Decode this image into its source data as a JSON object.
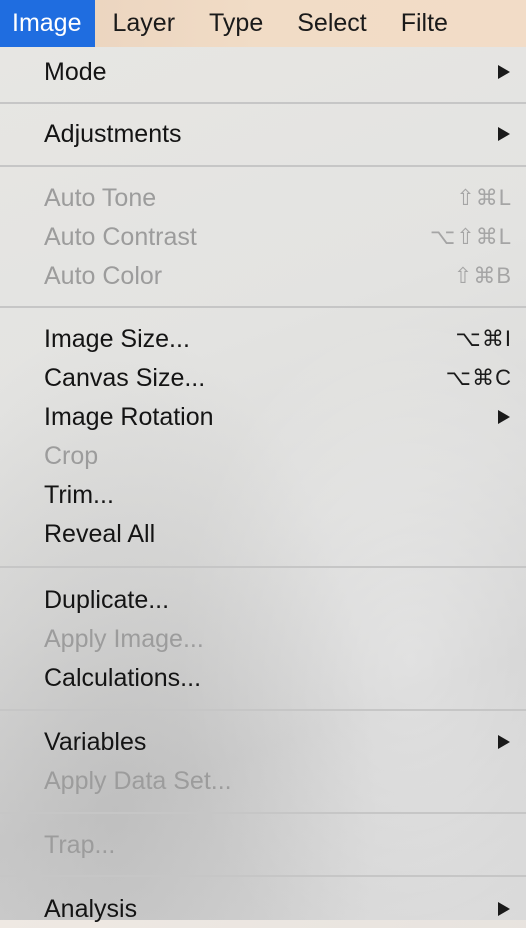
{
  "menubar": {
    "items": [
      {
        "label": "Image"
      },
      {
        "label": "Layer"
      },
      {
        "label": "Type"
      },
      {
        "label": "Select"
      },
      {
        "label": "Filte"
      }
    ]
  },
  "menu": {
    "items": [
      {
        "label": "Mode",
        "submenu": true
      },
      {
        "label": "Adjustments",
        "submenu": true
      },
      {
        "label": "Auto Tone",
        "shortcut": "⇧⌘L",
        "disabled": true
      },
      {
        "label": "Auto Contrast",
        "shortcut": "⌥⇧⌘L",
        "disabled": true
      },
      {
        "label": "Auto Color",
        "shortcut": "⇧⌘B",
        "disabled": true
      },
      {
        "label": "Image Size...",
        "shortcut": "⌥⌘I"
      },
      {
        "label": "Canvas Size...",
        "shortcut": "⌥⌘C"
      },
      {
        "label": "Image Rotation",
        "submenu": true
      },
      {
        "label": "Crop",
        "disabled": true
      },
      {
        "label": "Trim..."
      },
      {
        "label": "Reveal All"
      },
      {
        "label": "Duplicate..."
      },
      {
        "label": "Apply Image...",
        "disabled": true
      },
      {
        "label": "Calculations..."
      },
      {
        "label": "Variables",
        "submenu": true
      },
      {
        "label": "Apply Data Set...",
        "disabled": true
      },
      {
        "label": "Trap...",
        "disabled": true
      },
      {
        "label": "Analysis",
        "submenu": true
      }
    ]
  },
  "colors": {
    "menubar_active": "#1f6de0",
    "disabled_text": "#9c9c9c"
  },
  "icons": {
    "submenu": "chevron-right-icon"
  }
}
